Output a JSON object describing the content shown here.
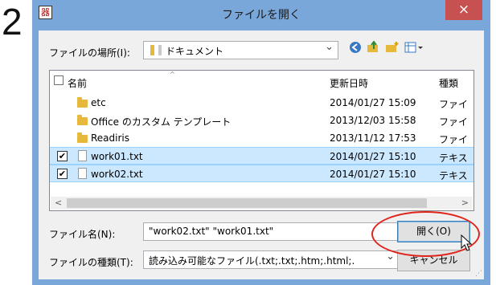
{
  "step_number": "2",
  "window": {
    "title": "ファイルを開く",
    "close_symbol": "×"
  },
  "location": {
    "label": "ファイルの場所(I):",
    "value": "ドキュメント"
  },
  "file_list": {
    "headers": {
      "name": "名前",
      "date": "更新日時",
      "type": "種類"
    },
    "rows": [
      {
        "name": "etc",
        "date": "2014/01/27 15:09",
        "type": "ファイ",
        "kind": "folder",
        "selected": false
      },
      {
        "name": "Office のカスタム テンプレート",
        "date": "2013/12/03 15:58",
        "type": "ファイ",
        "kind": "folder",
        "selected": false
      },
      {
        "name": "Readiris",
        "date": "2013/11/12 17:53",
        "type": "ファイ",
        "kind": "folder",
        "selected": false
      },
      {
        "name": "work01.txt",
        "date": "2014/01/27 15:10",
        "type": "テキス",
        "kind": "file",
        "selected": true,
        "check": "✔"
      },
      {
        "name": "work02.txt",
        "date": "2014/01/27 15:10",
        "type": "テキス",
        "kind": "file",
        "selected": true,
        "check": "✔"
      }
    ]
  },
  "filename": {
    "label": "ファイル名(N):",
    "value": "\"work02.txt\" \"work01.txt\""
  },
  "filetype": {
    "label": "ファイルの種類(T):",
    "value": "読み込み可能なファイル(.txt;.txt;.htm;.html;."
  },
  "buttons": {
    "open": "開く(O)",
    "cancel": "キャンセル"
  },
  "icons": {
    "dropdown": "⌄",
    "back": "back-arrow-icon",
    "up": "up-folder-icon",
    "new_folder": "new-folder-icon",
    "view_menu": "view-menu-icon"
  },
  "colors": {
    "frame": "#7aa7d9",
    "close": "#c75050",
    "selection": "#cce8ff",
    "annotation": "#e0241b"
  }
}
